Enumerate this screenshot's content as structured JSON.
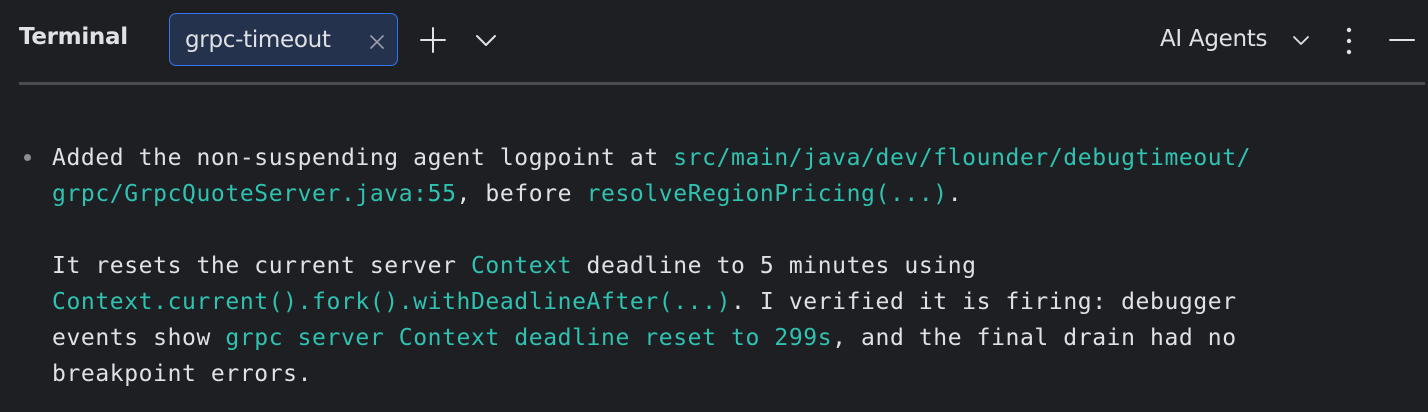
{
  "header": {
    "title": "Terminal",
    "tab_label": "grpc-timeout",
    "agents_label": "AI Agents"
  },
  "icons": {
    "tab_close": "close-icon",
    "new_tab": "plus-icon",
    "tab_menu": "chevron-down-icon",
    "agents_menu": "chevron-down-icon",
    "more": "vertical-ellipsis-icon",
    "minimize": "minimize-icon"
  },
  "colors": {
    "accent": "#3574f0",
    "link": "#2fc2b1",
    "background": "#1e1f22",
    "text": "#dfe1e5"
  },
  "output": {
    "line1_a": "Added the non-suspending agent logpoint at ",
    "line1_path": "src/main/java/dev/flounder/debugtimeout/",
    "line2_path": "grpc/GrpcQuoteServer.java:55",
    "line2_b": ", before ",
    "line2_code": "resolveRegionPricing(...)",
    "line2_c": ".",
    "line3_a": "It resets the current server ",
    "line3_code": "Context",
    "line3_b": " deadline to 5 minutes using",
    "line4_code": "Context.current().fork().withDeadlineAfter(...)",
    "line4_b": ". I verified it is firing: debugger",
    "line5_a": "events show ",
    "line5_code": "grpc server Context deadline reset to 299s",
    "line5_b": ", and the final drain had no",
    "line6": "breakpoint errors."
  }
}
